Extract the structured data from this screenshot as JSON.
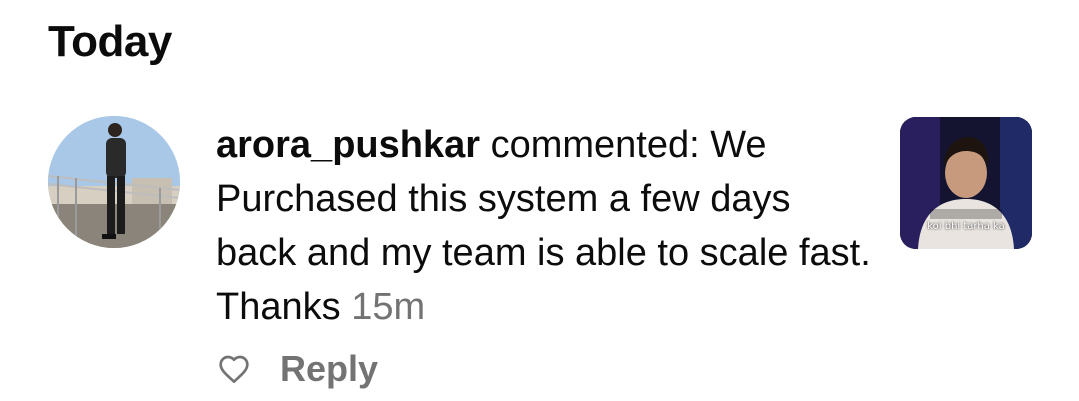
{
  "section": {
    "title": "Today"
  },
  "comment": {
    "username": "arora_pushkar",
    "action": "commented:",
    "text": "We Purchased this system a few days back and my team is able to scale fast. Thanks",
    "time": "15m"
  },
  "actions": {
    "reply_label": "Reply",
    "like_icon": "heart-outline-icon"
  },
  "thumbnail": {
    "caption": "koi bhi tarha ka"
  },
  "colors": {
    "text": "#0c0c0c",
    "muted": "#737373",
    "background": "#ffffff"
  }
}
